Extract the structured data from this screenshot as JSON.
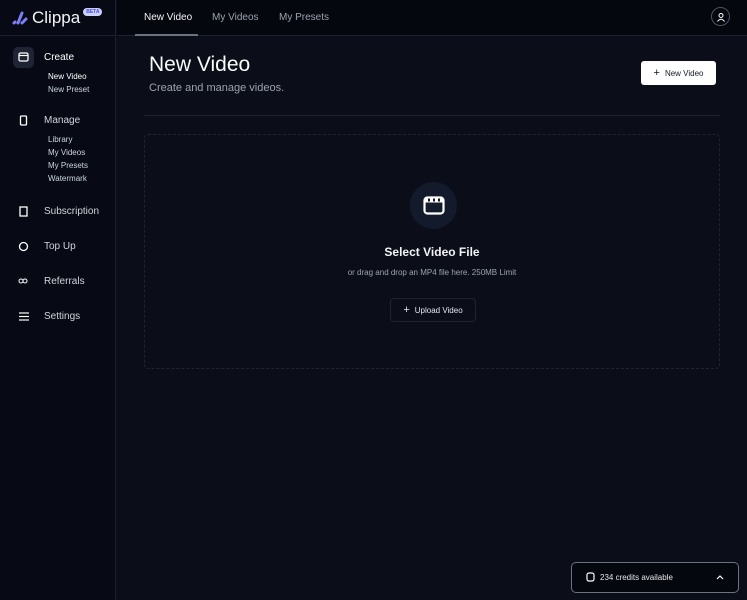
{
  "brand": {
    "name": "Clippa",
    "badge": "BETA"
  },
  "sidebar": {
    "create": {
      "label": "Create",
      "items": [
        "New Video",
        "New Preset"
      ]
    },
    "manage": {
      "label": "Manage",
      "items": [
        "Library",
        "My Videos",
        "My Presets",
        "Watermark"
      ]
    },
    "subscription": "Subscription",
    "topup": "Top Up",
    "referrals": "Referrals",
    "settings": "Settings"
  },
  "tabs": [
    "New Video",
    "My Videos",
    "My Presets"
  ],
  "page": {
    "title": "New Video",
    "subtitle": "Create and manage videos.",
    "new_button": "New Video"
  },
  "dropzone": {
    "title": "Select Video File",
    "hint": "or drag and drop an MP4 file here. 250MB Limit",
    "upload_button": "Upload Video"
  },
  "credits": {
    "label": "234 credits available"
  }
}
